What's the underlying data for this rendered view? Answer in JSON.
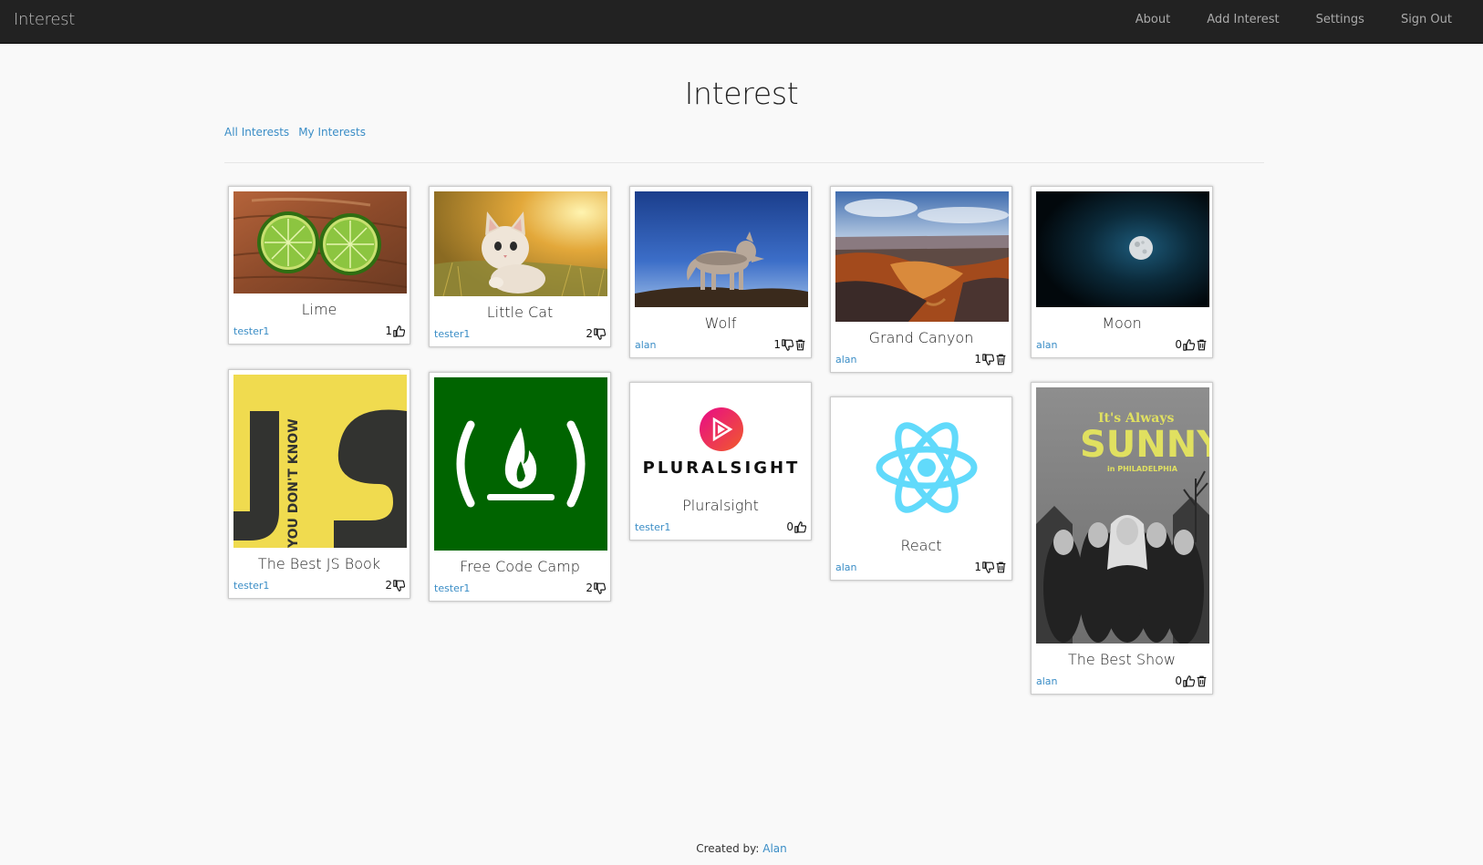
{
  "navbar": {
    "brand": "Interest",
    "links": [
      "About",
      "Add Interest",
      "Settings",
      "Sign Out"
    ]
  },
  "page": {
    "title": "Interest",
    "filters": [
      "All Interests",
      "My Interests"
    ]
  },
  "cards": [
    {
      "title": "Lime",
      "owner": "tester1",
      "count": "1",
      "vote_icon": "thumbs-up-icon",
      "deletable": false
    },
    {
      "title": "Little Cat",
      "owner": "tester1",
      "count": "2",
      "vote_icon": "thumbs-down-icon",
      "deletable": false
    },
    {
      "title": "Wolf",
      "owner": "alan",
      "count": "1",
      "vote_icon": "thumbs-down-icon",
      "deletable": true
    },
    {
      "title": "Grand Canyon",
      "owner": "alan",
      "count": "1",
      "vote_icon": "thumbs-down-icon",
      "deletable": true
    },
    {
      "title": "Moon",
      "owner": "alan",
      "count": "0",
      "vote_icon": "thumbs-up-icon",
      "deletable": true
    },
    {
      "title": "The Best JS Book",
      "owner": "tester1",
      "count": "2",
      "vote_icon": "thumbs-down-icon",
      "deletable": false
    },
    {
      "title": "Free Code Camp",
      "owner": "tester1",
      "count": "2",
      "vote_icon": "thumbs-down-icon",
      "deletable": false
    },
    {
      "title": "Pluralsight",
      "owner": "tester1",
      "count": "0",
      "vote_icon": "thumbs-up-icon",
      "deletable": false
    },
    {
      "title": "React",
      "owner": "alan",
      "count": "1",
      "vote_icon": "thumbs-down-icon",
      "deletable": true
    },
    {
      "title": "The Best Show",
      "owner": "alan",
      "count": "0",
      "vote_icon": "thumbs-up-icon",
      "deletable": true
    }
  ],
  "image_text": {
    "js_book": "YOU DON'T KNOW",
    "pluralsight": "PLURALSIGHT",
    "show_line1": "It's Always",
    "show_line2": "SUNNY",
    "show_line3": "in PHILADELPHIA"
  },
  "footer": {
    "prefix": "Created by:",
    "author": "Alan"
  }
}
